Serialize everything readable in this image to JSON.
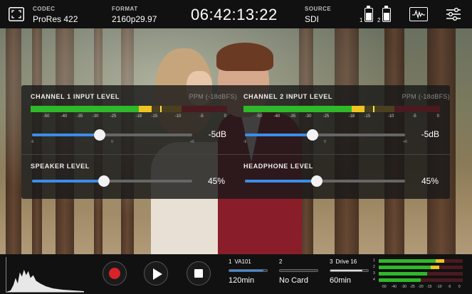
{
  "topbar": {
    "codec_label": "CODEC",
    "codec_value": "ProRes 422",
    "format_label": "FORMAT",
    "format_value": "2160p29.97",
    "timecode": "06:42:13:22",
    "source_label": "SOURCE",
    "source_value": "SDI",
    "battery_1_num": "1",
    "battery_2_num": "2",
    "battery_1_level": 0.7,
    "battery_2_level": 0.7,
    "icons": [
      "frame-guides-icon",
      "battery-icon",
      "waveform-scope-icon",
      "settings-sliders-icon"
    ]
  },
  "audio": {
    "ch1": {
      "title": "CHANNEL 1 INPUT LEVEL",
      "ppm": "PPM (-18dBFS)",
      "gain_value": "-5dB",
      "gain_fraction": 0.42
    },
    "ch2": {
      "title": "CHANNEL 2 INPUT LEVEL",
      "ppm": "PPM (-18dBFS)",
      "gain_value": "-5dB",
      "gain_fraction": 0.42
    },
    "meter_scale": [
      "-50",
      "-40",
      "-35",
      "-30",
      "-25",
      "-18",
      "-15",
      "-10",
      "-5",
      "0"
    ],
    "gain_ticks": [
      "-6",
      "0",
      "+6"
    ],
    "speaker": {
      "title": "SPEAKER LEVEL",
      "value": "45%",
      "fraction": 0.45
    },
    "headphone": {
      "title": "HEADPHONE LEVEL",
      "value": "45%",
      "fraction": 0.45
    }
  },
  "bottombar": {
    "slots": [
      {
        "num": "1",
        "name": "VA101",
        "value": "120min",
        "fill": 0.9,
        "color": "#3a8de8"
      },
      {
        "num": "2",
        "name": "",
        "value": "No Card",
        "fill": 0.0,
        "color": "#888888"
      },
      {
        "num": "3",
        "name": "Drive 16",
        "value": "60min",
        "fill": 0.85,
        "color": "#dddddd"
      }
    ],
    "mini_meter_nums": [
      "1",
      "2",
      "3",
      "4"
    ],
    "mini_meter_scale": [
      "-50",
      "-40",
      "-30",
      "-25",
      "-20",
      "-15",
      "-10",
      "-5",
      "0"
    ]
  },
  "colors": {
    "accent": "#3a8de8",
    "record": "#d8232a",
    "meter_green": "#2fb82a",
    "meter_yellow": "#f0c420"
  }
}
